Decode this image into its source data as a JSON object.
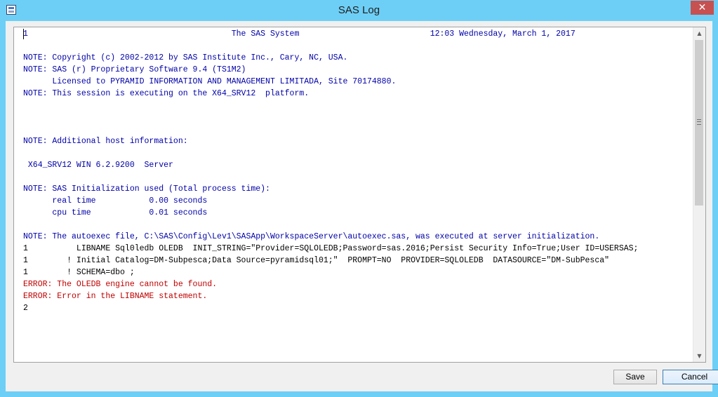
{
  "window": {
    "title": "SAS Log",
    "app_icon": "sas-log-icon",
    "close_glyph": "✕"
  },
  "log": {
    "lines": [
      {
        "text": "1                                          The SAS System                           12:03 Wednesday, March 1, 2017",
        "style": "blue"
      },
      {
        "text": "",
        "style": "blue"
      },
      {
        "text": "NOTE: Copyright (c) 2002-2012 by SAS Institute Inc., Cary, NC, USA.",
        "style": "blue"
      },
      {
        "text": "NOTE: SAS (r) Proprietary Software 9.4 (TS1M2)",
        "style": "blue"
      },
      {
        "text": "      Licensed to PYRAMID INFORMATION AND MANAGEMENT LIMITADA, Site 70174880.",
        "style": "blue"
      },
      {
        "text": "NOTE: This session is executing on the X64_SRV12  platform.",
        "style": "blue"
      },
      {
        "text": "",
        "style": "blue"
      },
      {
        "text": "",
        "style": "blue"
      },
      {
        "text": "",
        "style": "blue"
      },
      {
        "text": "NOTE: Additional host information:",
        "style": "blue"
      },
      {
        "text": "",
        "style": "blue"
      },
      {
        "text": " X64_SRV12 WIN 6.2.9200  Server",
        "style": "blue"
      },
      {
        "text": "",
        "style": "blue"
      },
      {
        "text": "NOTE: SAS Initialization used (Total process time):",
        "style": "blue"
      },
      {
        "text": "      real time           0.00 seconds",
        "style": "blue"
      },
      {
        "text": "      cpu time            0.01 seconds",
        "style": "blue"
      },
      {
        "text": "",
        "style": "blue"
      },
      {
        "text": "NOTE: The autoexec file, C:\\SAS\\Config\\Lev1\\SASApp\\WorkspaceServer\\autoexec.sas, was executed at server initialization.",
        "style": "blue"
      },
      {
        "text": "1          LIBNAME Sql0ledb OLEDB  INIT_STRING=\"Provider=SQLOLEDB;Password=sas.2016;Persist Security Info=True;User ID=USERSAS;",
        "style": "black"
      },
      {
        "text": "1        ! Initial Catalog=DM-Subpesca;Data Source=pyramidsql01;\"  PROMPT=NO  PROVIDER=SQLOLEDB  DATASOURCE=\"DM-SubPesca\"",
        "style": "black"
      },
      {
        "text": "1        ! SCHEMA=dbo ;",
        "style": "black"
      },
      {
        "text": "ERROR: The OLEDB engine cannot be found.",
        "style": "red"
      },
      {
        "text": "ERROR: Error in the LIBNAME statement.",
        "style": "red"
      },
      {
        "text": "2",
        "style": "black"
      }
    ]
  },
  "scrollbar": {
    "up_arrow": "▲",
    "down_arrow": "▼"
  },
  "buttons": {
    "save_label": "Save",
    "cancel_label": "Cancel"
  }
}
